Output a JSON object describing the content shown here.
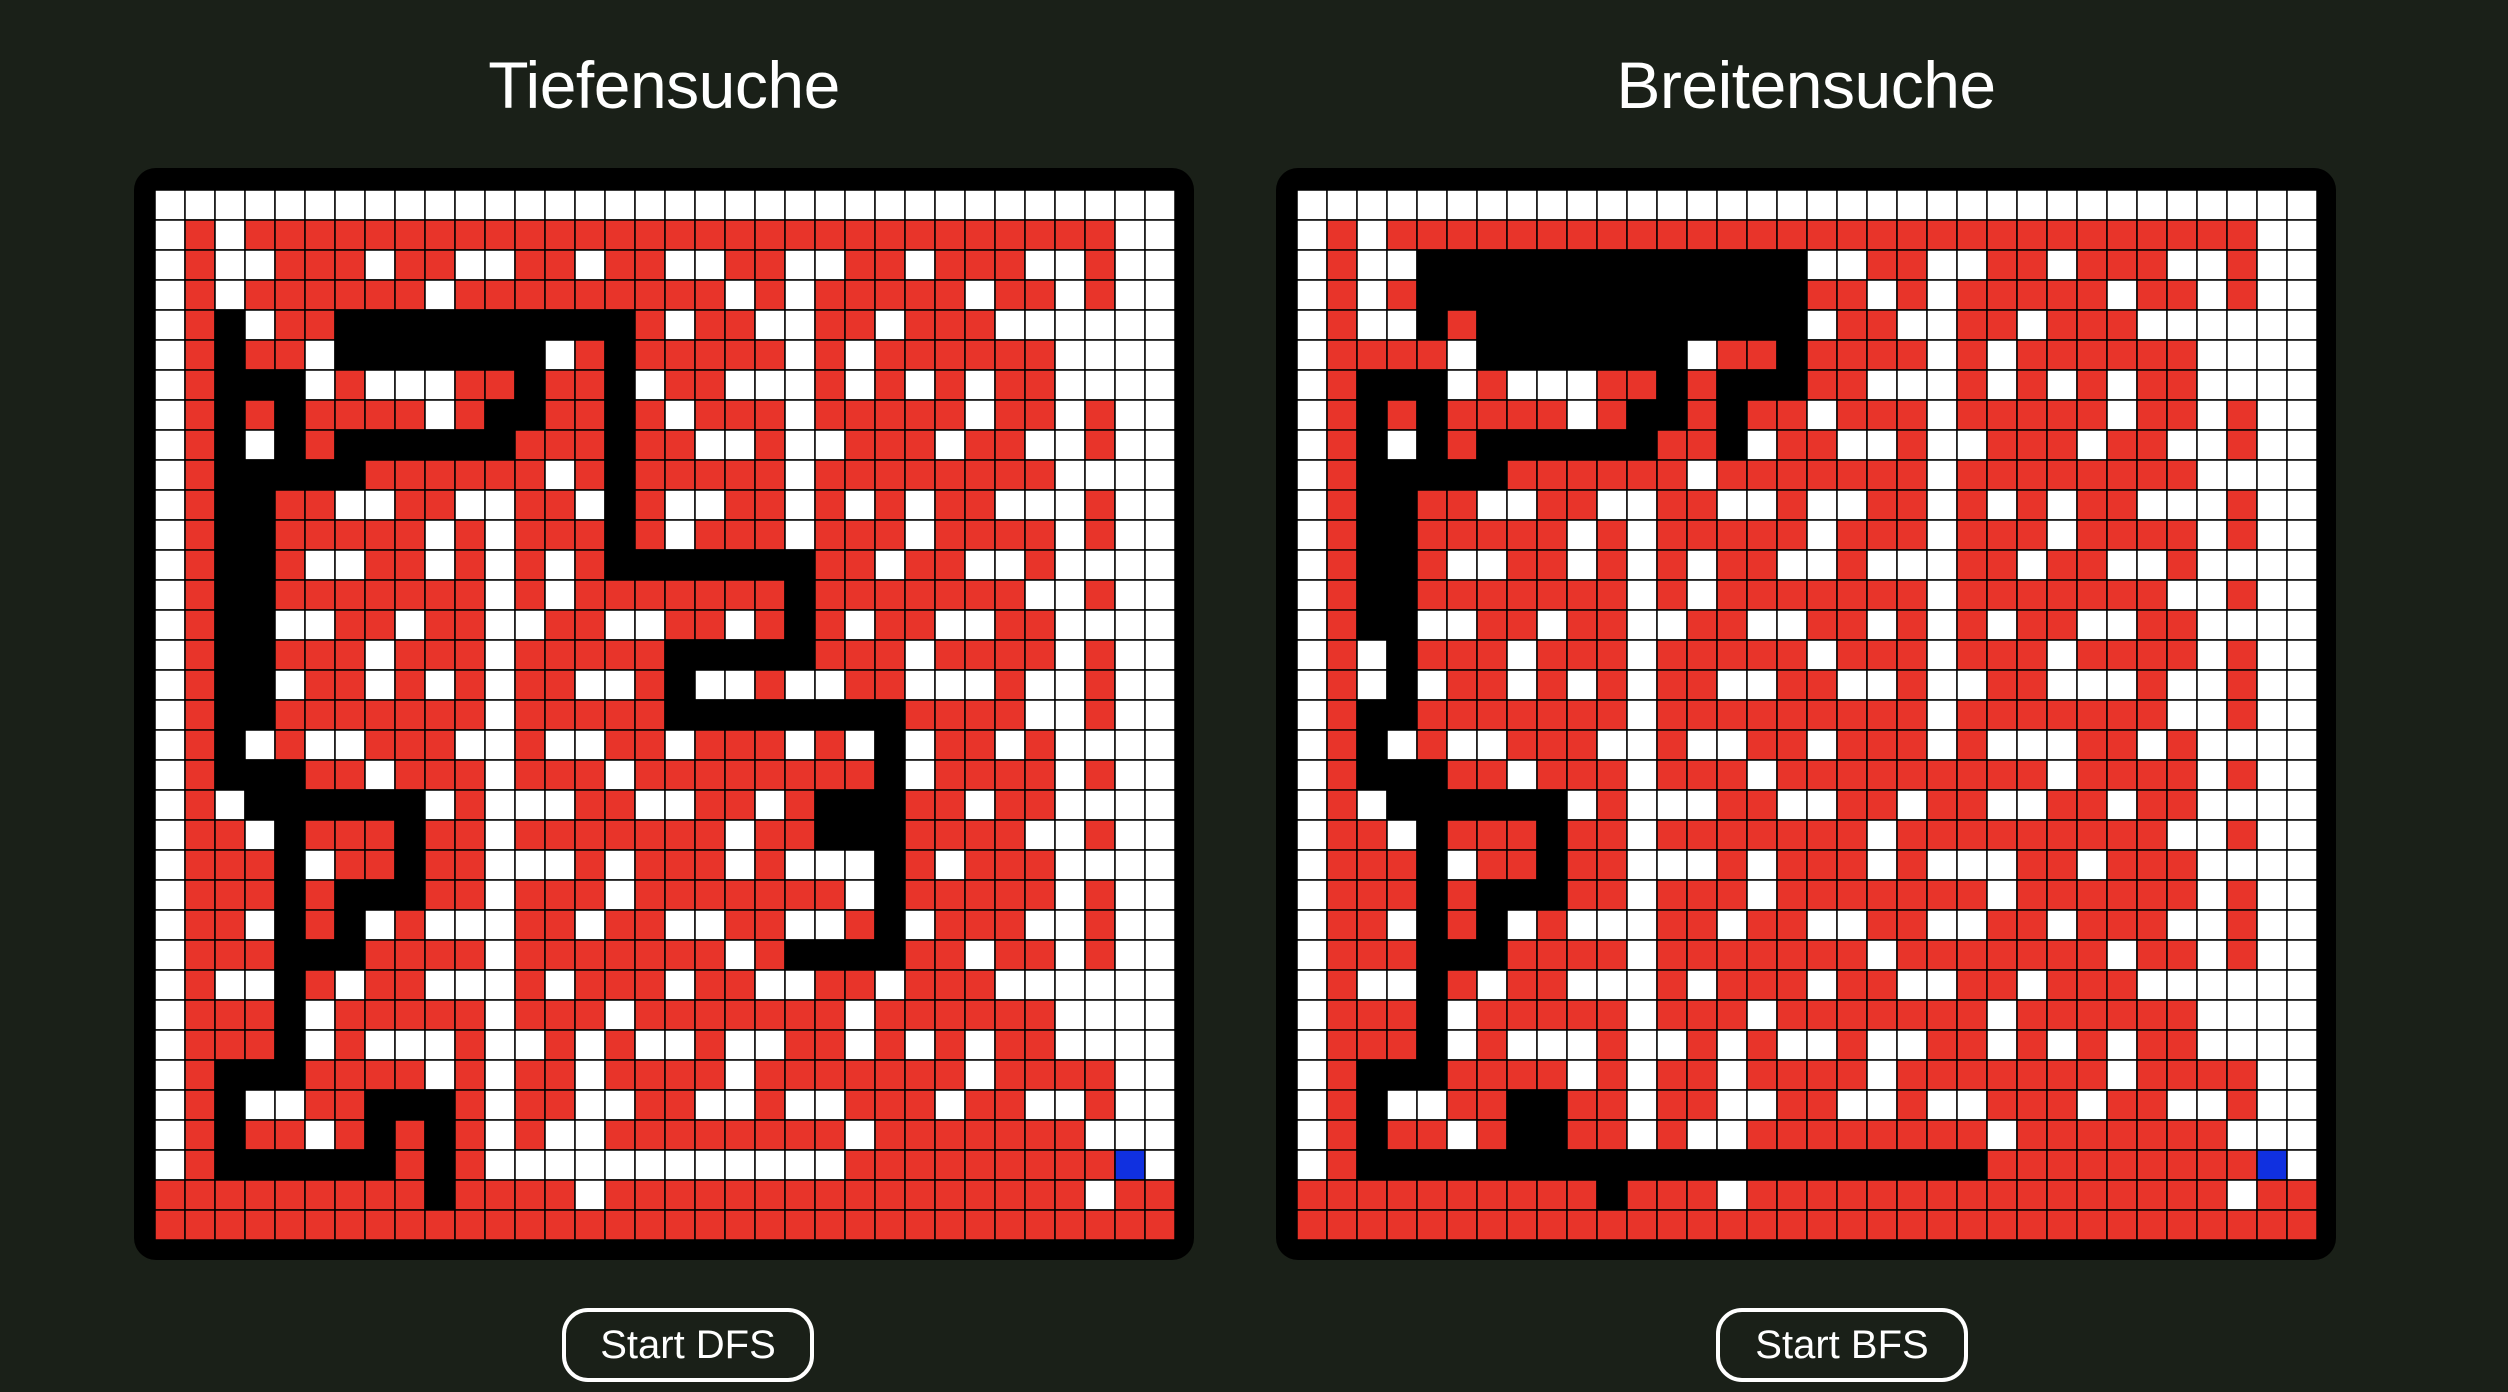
{
  "dfs": {
    "title": "Tiefensuche",
    "button_label": "Start DFS"
  },
  "bfs": {
    "title": "Breitensuche",
    "button_label": "Start BFS"
  },
  "colors": {
    "background": "#1a2018",
    "frame": "#000000",
    "cell_border": "#000000",
    "visited": "#e8342a",
    "unvisited": "#ffffff",
    "wall_path": "#000000",
    "goal": "#1030e0"
  },
  "grid": {
    "cols": 34,
    "rows": 35
  }
}
